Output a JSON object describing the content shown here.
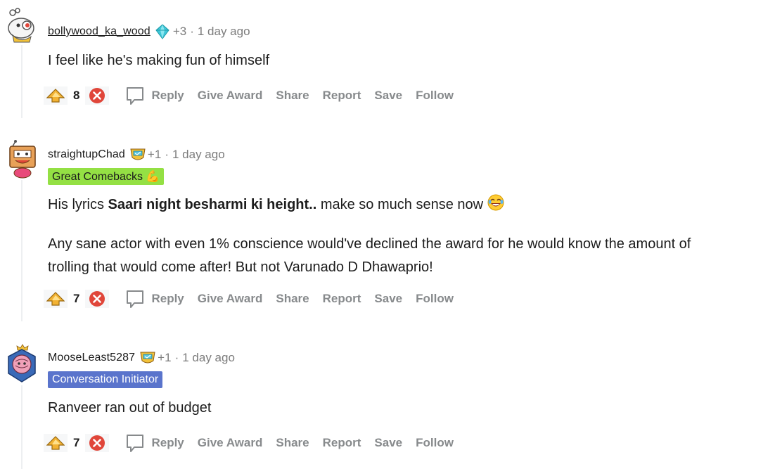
{
  "comments": [
    {
      "username": "bollywood_ka_wood",
      "award_count": "+3",
      "separator": "·",
      "timestamp": "1 day ago",
      "flair": "",
      "paragraphs": [
        "I feel like he's making fun of himself"
      ],
      "score": "8",
      "actions": {
        "reply": "Reply",
        "give_award": "Give Award",
        "share": "Share",
        "report": "Report",
        "save": "Save",
        "follow": "Follow"
      }
    },
    {
      "username": "straightupChad",
      "award_count": "+1",
      "separator": "·",
      "timestamp": "1 day ago",
      "flair": "Great Comebacks 💪",
      "paragraphs": [
        {
          "prefix": "His lyrics ",
          "bold": "Saari night besharmi ki height..",
          "suffix": " make so much sense now "
        },
        "Any sane actor with even 1% conscience would've declined the award for he would know the amount of trolling that would come after! But not Varunado D Dhawaprio!"
      ],
      "score": "7",
      "actions": {
        "reply": "Reply",
        "give_award": "Give Award",
        "share": "Share",
        "report": "Report",
        "save": "Save",
        "follow": "Follow"
      }
    },
    {
      "username": "MooseLeast5287",
      "award_count": "+1",
      "separator": "·",
      "timestamp": "1 day ago",
      "flair": "Conversation Initiator",
      "paragraphs": [
        "Ranveer ran out of budget"
      ],
      "score": "7",
      "actions": {
        "reply": "Reply",
        "give_award": "Give Award",
        "share": "Share",
        "report": "Report",
        "save": "Save",
        "follow": "Follow"
      }
    }
  ],
  "colors": {
    "flair_great_comebacks_bg": "#94e044",
    "flair_conversation_bg": "#5a74cc",
    "meta_gray": "#7c7c7c",
    "action_gray": "#878a8c",
    "downvote_red": "#e0463a",
    "upvote_gold": "#f2b233"
  },
  "icons": {
    "upvote": "golden-upvote-icon",
    "downvote": "red-x-downvote-icon",
    "reply": "speech-bubble-icon",
    "award_1": "diamond-award-icon",
    "award_2": "trophy-award-icon",
    "emoji_laugh": "tears-of-joy-emoji-icon"
  }
}
